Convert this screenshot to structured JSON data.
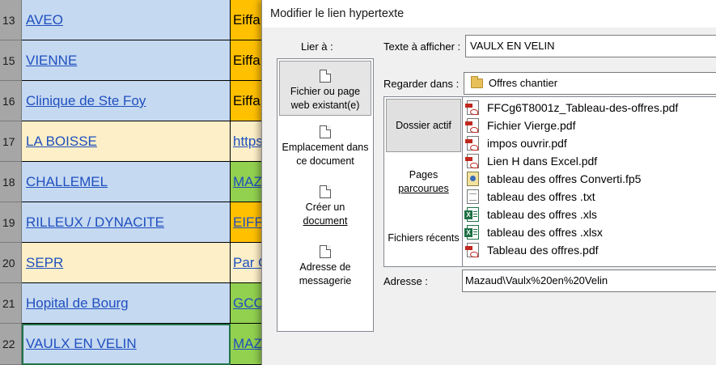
{
  "sheet": {
    "rows": [
      {
        "num": "13",
        "name": "AVEO",
        "colB": "Eiffa"
      },
      {
        "num": "15",
        "name": "VIENNE",
        "colB": "Eiffa"
      },
      {
        "num": "16",
        "name": "Clinique de Ste Foy",
        "colB": "Eiffa"
      },
      {
        "num": "17",
        "name": "LA BOISSE",
        "colB": "https"
      },
      {
        "num": "18",
        "name": "CHALLEMEL",
        "colB": "MAZ"
      },
      {
        "num": "19",
        "name": "RILLEUX / DYNACITE",
        "colB": "EIFFA"
      },
      {
        "num": "20",
        "name": "SEPR",
        "colB": "Par C"
      },
      {
        "num": "21",
        "name": "Hopital de Bourg",
        "colB": "GCC"
      },
      {
        "num": "22",
        "name": "VAULX EN VELIN",
        "colB": "MAZ"
      }
    ]
  },
  "dialog": {
    "title": "Modifier le lien hypertexte",
    "link_to_label": "Lier à :",
    "link_to": [
      {
        "label_line1": "Fichier ou page",
        "label_line2": "web existant(e)"
      },
      {
        "label_line1": "Emplacement dans",
        "label_line2": "ce document"
      },
      {
        "label_line1": "Créer un",
        "label_line2": "document"
      },
      {
        "label_line1": "Adresse de",
        "label_line2": "messagerie"
      }
    ],
    "text_to_display_label": "Texte à afficher :",
    "text_to_display_value": "VAULX EN VELIN",
    "look_in_label": "Regarder dans :",
    "look_in_value": "Offres chantier",
    "nav": [
      {
        "label_line1": "Dossier actif",
        "label_line2": ""
      },
      {
        "label_line1": "Pages",
        "label_line2": "parcourues"
      },
      {
        "label_line1": "Fichiers récents",
        "label_line2": ""
      }
    ],
    "files": [
      {
        "name": "FFCg6T8001z_Tableau-des-offres.pdf",
        "icon": "pdf-icon"
      },
      {
        "name": "Fichier Vierge.pdf",
        "icon": "pdf-icon"
      },
      {
        "name": "impos ouvrir.pdf",
        "icon": "pdf-icon"
      },
      {
        "name": "Lien H dans Excel.pdf",
        "icon": "pdf-icon"
      },
      {
        "name": "tableau des offres  Converti.fp5",
        "icon": "fp5-icon"
      },
      {
        "name": "tableau des offres .txt",
        "icon": "txt-icon"
      },
      {
        "name": "tableau des offres .xls",
        "icon": "excel-icon"
      },
      {
        "name": "tableau des offres .xlsx",
        "icon": "excel-icon"
      },
      {
        "name": "Tableau des offres.pdf",
        "icon": "pdf-icon"
      }
    ],
    "address_label": "Adresse :",
    "address_value": "Mazaud\\Vaulx%20en%20Velin"
  }
}
